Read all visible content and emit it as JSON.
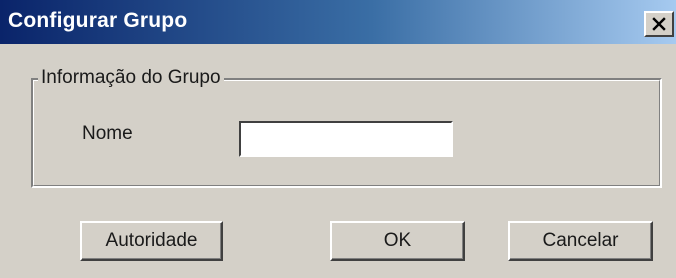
{
  "window": {
    "title": "Configurar Grupo",
    "close_label": "X",
    "close_icon": "close-icon"
  },
  "group": {
    "legend": "Informação do Grupo",
    "name_label": "Nome",
    "name_value": "",
    "name_placeholder": ""
  },
  "buttons": {
    "authority": "Autoridade",
    "ok": "OK",
    "cancel": "Cancelar"
  },
  "colors": {
    "titlebar_start": "#0a246a",
    "titlebar_end": "#a6caf0",
    "dialog_face": "#d4d0c8",
    "input_background": "#ffffff"
  }
}
